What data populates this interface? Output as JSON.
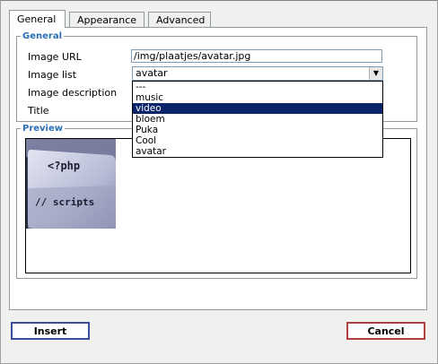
{
  "tabs": [
    {
      "label": "General"
    },
    {
      "label": "Appearance"
    },
    {
      "label": "Advanced"
    }
  ],
  "general": {
    "legend": "General",
    "image_url_label": "Image URL",
    "image_url_value": "/img/plaatjes/avatar.jpg",
    "image_list_label": "Image list",
    "image_list_selected": "avatar",
    "image_description_label": "Image description",
    "title_label": "Title"
  },
  "dropdown": {
    "options": [
      "---",
      "music",
      "video",
      "bloem",
      "Puka",
      "Cool",
      "avatar"
    ],
    "highlighted": "video"
  },
  "preview": {
    "legend": "Preview",
    "image_text_line1": "<?php",
    "image_text_line2": "// scripts"
  },
  "buttons": {
    "insert": "Insert",
    "cancel": "Cancel"
  },
  "colors": {
    "legend": "#2b6fb6",
    "highlight": "#0a246a",
    "insert_border": "#3a4e9e",
    "cancel_border": "#b04040"
  }
}
